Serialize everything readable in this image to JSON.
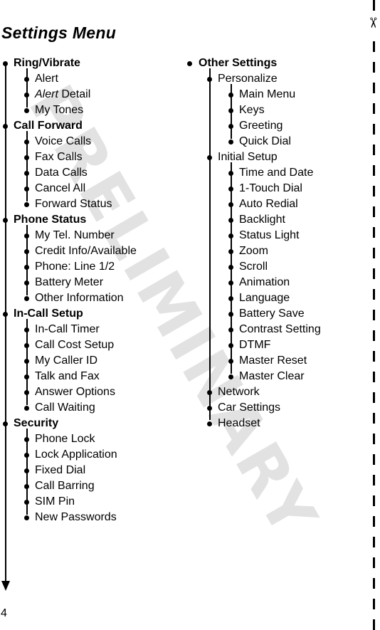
{
  "page": {
    "title": "Settings Menu",
    "page_number": "4",
    "watermark": "PRELIMINARY",
    "cut_icon": "scissors-icon"
  },
  "left_column": [
    {
      "label": "Ring/Vibrate",
      "items": [
        {
          "label": "Alert"
        },
        {
          "label_em": "Alert",
          "label": " Detail"
        },
        {
          "label": "My Tones"
        }
      ]
    },
    {
      "label": "Call Forward",
      "items": [
        {
          "label": "Voice Calls"
        },
        {
          "label": "Fax Calls"
        },
        {
          "label": "Data Calls"
        },
        {
          "label": "Cancel All"
        },
        {
          "label": "Forward Status"
        }
      ]
    },
    {
      "label": "Phone Status",
      "items": [
        {
          "label": "My Tel. Number"
        },
        {
          "label": "Credit Info/Available"
        },
        {
          "label": "Phone: Line 1/2"
        },
        {
          "label": "Battery Meter"
        },
        {
          "label": "Other Information"
        }
      ]
    },
    {
      "label": "In-Call Setup",
      "items": [
        {
          "label": "In-Call Timer"
        },
        {
          "label": "Call Cost Setup"
        },
        {
          "label": "My Caller ID"
        },
        {
          "label": "Talk and Fax"
        },
        {
          "label": "Answer Options"
        },
        {
          "label": "Call Waiting"
        }
      ]
    },
    {
      "label": "Security",
      "items": [
        {
          "label": "Phone Lock"
        },
        {
          "label": "Lock Application"
        },
        {
          "label": "Fixed Dial"
        },
        {
          "label": "Call Barring"
        },
        {
          "label": "SIM Pin"
        },
        {
          "label": "New Passwords"
        }
      ]
    }
  ],
  "right_column": {
    "label": "Other Settings",
    "items": [
      {
        "label": "Personalize",
        "items": [
          {
            "label": "Main Menu"
          },
          {
            "label": "Keys"
          },
          {
            "label": "Greeting"
          },
          {
            "label": "Quick Dial"
          }
        ]
      },
      {
        "label": "Initial Setup",
        "items": [
          {
            "label": "Time and Date"
          },
          {
            "label": "1-Touch Dial"
          },
          {
            "label": "Auto Redial"
          },
          {
            "label": "Backlight"
          },
          {
            "label": "Status Light"
          },
          {
            "label": "Zoom"
          },
          {
            "label": "Scroll"
          },
          {
            "label": "Animation"
          },
          {
            "label": "Language"
          },
          {
            "label": "Battery Save"
          },
          {
            "label": "Contrast Setting"
          },
          {
            "label": "DTMF"
          },
          {
            "label": "Master Reset"
          },
          {
            "label": "Master Clear"
          }
        ]
      },
      {
        "label": "Network"
      },
      {
        "label": "Car Settings"
      },
      {
        "label": "Headset"
      }
    ]
  }
}
